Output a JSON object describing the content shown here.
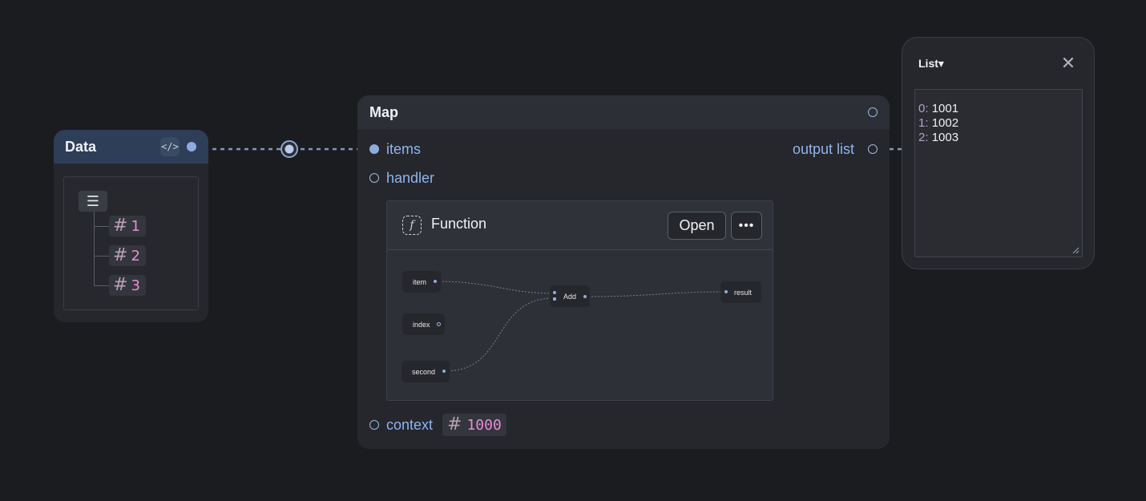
{
  "data_node": {
    "title": "Data",
    "code_icon": "</>",
    "list_icon": "☰",
    "items": [
      {
        "hash": "#",
        "value": "1"
      },
      {
        "hash": "#",
        "value": "2"
      },
      {
        "hash": "#",
        "value": "3"
      }
    ]
  },
  "map_node": {
    "title": "Map",
    "inputs": {
      "items": "items",
      "handler": "handler",
      "context": "context"
    },
    "output_label": "output list",
    "context_value": {
      "hash": "#",
      "value": "1000"
    },
    "function": {
      "title": "Function",
      "icon": "f",
      "open_label": "Open",
      "more_label": "•••",
      "graph_nodes": {
        "item": "item",
        "index": "index",
        "second": "second",
        "add": "Add",
        "result": "result"
      }
    }
  },
  "list_panel": {
    "title": "List▾",
    "close_icon": "✕",
    "rows": [
      {
        "index": "0:",
        "value": "1001"
      },
      {
        "index": "1:",
        "value": "1002"
      },
      {
        "index": "2:",
        "value": "1003"
      }
    ]
  },
  "colors": {
    "background": "#1a1c20",
    "node": "#25272c",
    "data_header": "#2e3d58",
    "port": "#8eabdd",
    "label": "#8eb4f0",
    "number": "#e58ed0"
  }
}
